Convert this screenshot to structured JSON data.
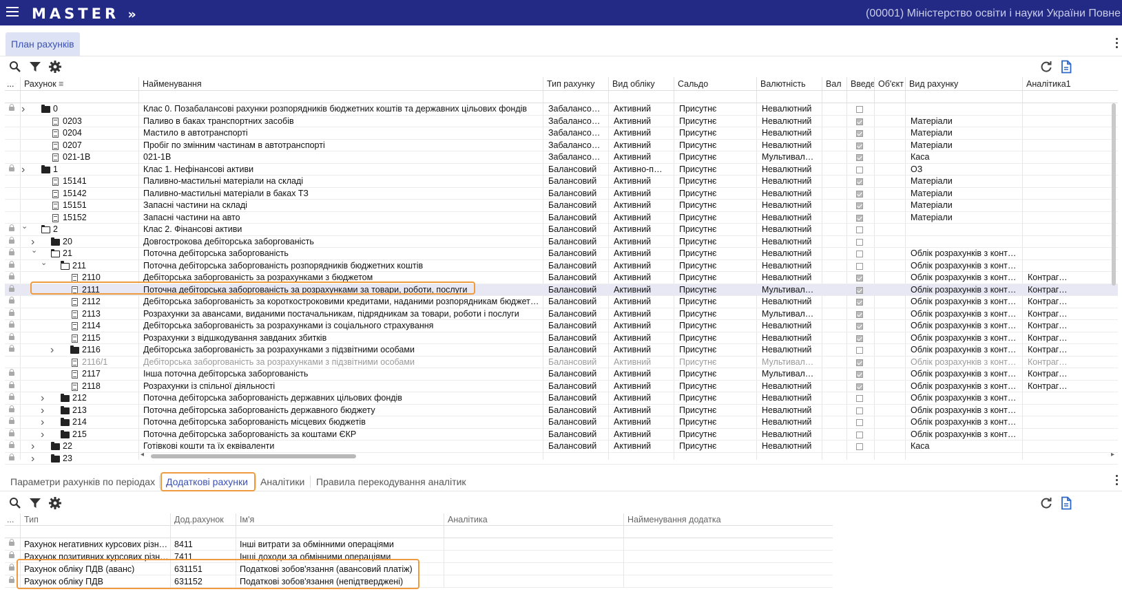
{
  "header": {
    "logo": "MASTER",
    "logo_suffix": "»",
    "org": "(00001) Міністерство освіти і науки України Повне"
  },
  "main_tab": {
    "label": "План рахунків"
  },
  "grid": {
    "columns": [
      "...",
      "Рахунок",
      "Найменування",
      "Тип рахунку",
      "Вид обліку",
      "Сальдо",
      "Валютність",
      "Вал",
      "Введен",
      "Об'єкт",
      "Вид рахунку",
      "Аналітика1"
    ],
    "rows": [
      {
        "lock": true,
        "chev": ">",
        "icon": "folder",
        "level": 0,
        "code": "0",
        "name": "Клас 0. Позабалансові рахунки розпорядників бюджетних коштів та державних цільових фондів",
        "type": "Забалансо…",
        "kind": "Активний",
        "saldo": "Присутнє",
        "cur": "Невалютний",
        "cb": false,
        "vid": "",
        "an": ""
      },
      {
        "lock": false,
        "chev": "",
        "icon": "doc",
        "level": 1,
        "code": "0203",
        "name": "Паливо в баках транспортних засобів",
        "type": "Забалансо…",
        "kind": "Активний",
        "saldo": "Присутнє",
        "cur": "Невалютний",
        "cb": true,
        "vid": "Матеріали",
        "an": ""
      },
      {
        "lock": false,
        "chev": "",
        "icon": "doc",
        "level": 1,
        "code": "0204",
        "name": "Мастило в автотранспорті",
        "type": "Забалансо…",
        "kind": "Активний",
        "saldo": "Присутнє",
        "cur": "Невалютний",
        "cb": true,
        "vid": "Матеріали",
        "an": ""
      },
      {
        "lock": false,
        "chev": "",
        "icon": "doc",
        "level": 1,
        "code": "0207",
        "name": "Пробіг по змінним частинам в автотранспорті",
        "type": "Забалансо…",
        "kind": "Активний",
        "saldo": "Присутнє",
        "cur": "Невалютний",
        "cb": true,
        "vid": "Матеріали",
        "an": ""
      },
      {
        "lock": false,
        "chev": "",
        "icon": "doc",
        "level": 1,
        "code": "021-1В",
        "name": "021-1В",
        "type": "Забалансо…",
        "kind": "Активний",
        "saldo": "Присутнє",
        "cur": "Мультивал…",
        "cb": true,
        "vid": "Каса",
        "an": ""
      },
      {
        "lock": true,
        "chev": ">",
        "icon": "folder",
        "level": 0,
        "code": "1",
        "name": "Клас 1. Нефінансові активи",
        "type": "Балансовий",
        "kind": "Активно-п…",
        "saldo": "Присутнє",
        "cur": "Невалютний",
        "cb": false,
        "vid": "ОЗ",
        "an": ""
      },
      {
        "lock": false,
        "chev": "",
        "icon": "doc",
        "level": 1,
        "code": "15141",
        "name": "Паливно-мастильні матеріали на складі",
        "type": "Балансовий",
        "kind": "Активний",
        "saldo": "Присутнє",
        "cur": "Невалютний",
        "cb": true,
        "vid": "Матеріали",
        "an": ""
      },
      {
        "lock": false,
        "chev": "",
        "icon": "doc",
        "level": 1,
        "code": "15142",
        "name": "Паливно-мастильні матеріали в баках ТЗ",
        "type": "Балансовий",
        "kind": "Активний",
        "saldo": "Присутнє",
        "cur": "Невалютний",
        "cb": true,
        "vid": "Матеріали",
        "an": ""
      },
      {
        "lock": false,
        "chev": "",
        "icon": "doc",
        "level": 1,
        "code": "15151",
        "name": "Запасні частини на складі",
        "type": "Балансовий",
        "kind": "Активний",
        "saldo": "Присутнє",
        "cur": "Невалютний",
        "cb": true,
        "vid": "Матеріали",
        "an": ""
      },
      {
        "lock": false,
        "chev": "",
        "icon": "doc",
        "level": 1,
        "code": "15152",
        "name": "Запасні частини на авто",
        "type": "Балансовий",
        "kind": "Активний",
        "saldo": "Присутнє",
        "cur": "Невалютний",
        "cb": true,
        "vid": "Матеріали",
        "an": ""
      },
      {
        "lock": true,
        "chev": "v",
        "icon": "folder-open",
        "level": 0,
        "code": "2",
        "name": "Клас 2. Фінансові активи",
        "type": "Балансовий",
        "kind": "Активний",
        "saldo": "Присутнє",
        "cur": "Невалютний",
        "cb": false,
        "vid": "",
        "an": ""
      },
      {
        "lock": true,
        "chev": ">",
        "icon": "folder",
        "level": 1,
        "code": "20",
        "name": "Довгострокова дебіторська заборгованість",
        "type": "Балансовий",
        "kind": "Активний",
        "saldo": "Присутнє",
        "cur": "Невалютний",
        "cb": false,
        "vid": "",
        "an": ""
      },
      {
        "lock": true,
        "chev": "v",
        "icon": "folder-open",
        "level": 1,
        "code": "21",
        "name": "Поточна дебіторська заборгованість",
        "type": "Балансовий",
        "kind": "Активний",
        "saldo": "Присутнє",
        "cur": "Невалютний",
        "cb": false,
        "vid": "Облік розрахунків з контрагентами",
        "an": ""
      },
      {
        "lock": true,
        "chev": "v",
        "icon": "folder-open",
        "level": 2,
        "code": "211",
        "name": "Поточна дебіторська заборгованість розпорядників бюджетних коштів",
        "type": "Балансовий",
        "kind": "Активний",
        "saldo": "Присутнє",
        "cur": "Невалютний",
        "cb": false,
        "vid": "Облік розрахунків з контрагентами",
        "an": ""
      },
      {
        "lock": true,
        "chev": "",
        "icon": "doc",
        "level": 3,
        "code": "2110",
        "name": "Дебіторська заборгованість за розрахунками з бюджетом",
        "type": "Балансовий",
        "kind": "Активний",
        "saldo": "Присутнє",
        "cur": "Невалютний",
        "cb": true,
        "vid": "Облік розрахунків з контрагентами",
        "an": "Контрагенти"
      },
      {
        "lock": true,
        "chev": "",
        "icon": "doc",
        "level": 3,
        "code": "2111",
        "name": "Поточна дебіторська заборгованість за розрахунками за товари, роботи, послуги",
        "type": "Балансовий",
        "kind": "Активний",
        "saldo": "Присутнє",
        "cur": "Мультивал…",
        "cb": true,
        "vid": "Облік розрахунків з контрагентами",
        "an": "Контрагенти",
        "selected": true
      },
      {
        "lock": true,
        "chev": "",
        "icon": "doc",
        "level": 3,
        "code": "2112",
        "name": "Дебіторська заборгованість за короткостроковими кредитами, наданими розпорядникам бюджетних коштів",
        "type": "Балансовий",
        "kind": "Активний",
        "saldo": "Присутнє",
        "cur": "Невалютний",
        "cb": true,
        "vid": "Облік розрахунків з контрагентами",
        "an": "Контрагенти"
      },
      {
        "lock": true,
        "chev": "",
        "icon": "doc",
        "level": 3,
        "code": "2113",
        "name": "Розрахунки за авансами, виданими постачальникам, підрядникам за товари, роботи і послуги",
        "type": "Балансовий",
        "kind": "Активний",
        "saldo": "Присутнє",
        "cur": "Мультивал…",
        "cb": true,
        "vid": "Облік розрахунків з контрагентами",
        "an": "Контрагенти"
      },
      {
        "lock": true,
        "chev": "",
        "icon": "doc",
        "level": 3,
        "code": "2114",
        "name": "Дебіторська заборгованість за розрахунками із соціального страхування",
        "type": "Балансовий",
        "kind": "Активний",
        "saldo": "Присутнє",
        "cur": "Невалютний",
        "cb": true,
        "vid": "Облік розрахунків з контрагентами",
        "an": "Контрагенти"
      },
      {
        "lock": true,
        "chev": "",
        "icon": "doc",
        "level": 3,
        "code": "2115",
        "name": "Розрахунки з відшкодування завданих збитків",
        "type": "Балансовий",
        "kind": "Активний",
        "saldo": "Присутнє",
        "cur": "Невалютний",
        "cb": true,
        "vid": "Облік розрахунків з контрагентами",
        "an": "Контрагенти"
      },
      {
        "lock": true,
        "chev": ">",
        "icon": "folder",
        "level": 3,
        "code": "2116",
        "name": "Дебіторська заборгованість за розрахунками з підзвітними особами",
        "type": "Балансовий",
        "kind": "Активний",
        "saldo": "Присутнє",
        "cur": "Невалютний",
        "cb": false,
        "vid": "Облік розрахунків з контрагентами",
        "an": "Контрагенти"
      },
      {
        "lock": false,
        "chev": "",
        "icon": "doc",
        "level": 3,
        "code": "2116/1",
        "name": "Дебіторська заборгованість за розрахунками з підзвітними особами",
        "type": "Балансовий",
        "kind": "Активний",
        "saldo": "Присутнє",
        "cur": "Мультивал…",
        "cb": true,
        "vid": "Облік розрахунків з контрагентами",
        "an": "Контрагенти",
        "dim": true
      },
      {
        "lock": true,
        "chev": "",
        "icon": "doc",
        "level": 3,
        "code": "2117",
        "name": "Інша поточна дебіторська заборгованість",
        "type": "Балансовий",
        "kind": "Активний",
        "saldo": "Присутнє",
        "cur": "Мультивал…",
        "cb": true,
        "vid": "Облік розрахунків з контрагентами",
        "an": "Контрагенти"
      },
      {
        "lock": true,
        "chev": "",
        "icon": "doc",
        "level": 3,
        "code": "2118",
        "name": "Розрахунки із спільної діяльності",
        "type": "Балансовий",
        "kind": "Активний",
        "saldo": "Присутнє",
        "cur": "Невалютний",
        "cb": true,
        "vid": "Облік розрахунків з контрагентами",
        "an": "Контрагенти"
      },
      {
        "lock": true,
        "chev": ">",
        "icon": "folder",
        "level": 2,
        "code": "212",
        "name": "Поточна дебіторська заборгованість державних цільових фондів",
        "type": "Балансовий",
        "kind": "Активний",
        "saldo": "Присутнє",
        "cur": "Невалютний",
        "cb": false,
        "vid": "Облік розрахунків з контрагентами",
        "an": ""
      },
      {
        "lock": true,
        "chev": ">",
        "icon": "folder",
        "level": 2,
        "code": "213",
        "name": "Поточна дебіторська заборгованість державного бюджету",
        "type": "Балансовий",
        "kind": "Активний",
        "saldo": "Присутнє",
        "cur": "Невалютний",
        "cb": false,
        "vid": "Облік розрахунків з контрагентами",
        "an": ""
      },
      {
        "lock": true,
        "chev": ">",
        "icon": "folder",
        "level": 2,
        "code": "214",
        "name": "Поточна дебіторська заборгованість місцевих бюджетів",
        "type": "Балансовий",
        "kind": "Активний",
        "saldo": "Присутнє",
        "cur": "Невалютний",
        "cb": false,
        "vid": "Облік розрахунків з контрагентами",
        "an": ""
      },
      {
        "lock": true,
        "chev": ">",
        "icon": "folder",
        "level": 2,
        "code": "215",
        "name": "Поточна дебіторська заборгованість за коштами ЄКР",
        "type": "Балансовий",
        "kind": "Активний",
        "saldo": "Присутнє",
        "cur": "Невалютний",
        "cb": false,
        "vid": "Облік розрахунків з контрагентами",
        "an": ""
      },
      {
        "lock": true,
        "chev": ">",
        "icon": "folder",
        "level": 1,
        "code": "22",
        "name": "Готівкові кошти та їх еквіваленти",
        "type": "Балансовий",
        "kind": "Активний",
        "saldo": "Присутнє",
        "cur": "Невалютний",
        "cb": false,
        "vid": "Каса",
        "an": ""
      },
      {
        "lock": true,
        "chev": ">",
        "icon": "folder",
        "level": 1,
        "code": "23",
        "name": "",
        "type": "",
        "kind": "",
        "saldo": "",
        "cur": "",
        "cb": null,
        "vid": "",
        "an": ""
      }
    ]
  },
  "subtabs": [
    "Параметри рахунків по періодах",
    "Додаткові рахунки",
    "Аналітики",
    "Правила перекодування аналітик"
  ],
  "grid2": {
    "columns": [
      "...",
      "Тип",
      "Дод.рахунок",
      "Ім'я",
      "Аналітика",
      "Найменування додатка"
    ],
    "rows": [
      {
        "type": "Рахунок негативних курсових різниць",
        "acc": "8411",
        "name": "Інші витрати за обмінними операціями"
      },
      {
        "type": "Рахунок позитивних курсових різниць",
        "acc": "7411",
        "name": "Інші доходи за обмінними операціями"
      },
      {
        "type": "Рахунок обліку ПДВ (аванс)",
        "acc": "631151",
        "name": "Податкові зобов'язання (авансовий платіж)"
      },
      {
        "type": "Рахунок обліку ПДВ",
        "acc": "631152",
        "name": "Податкові зобов'язання (непідтверджені)"
      }
    ]
  },
  "colors": {
    "header_bg": "#232a86",
    "accent": "#3b52b4",
    "highlight": "#f09a3e"
  }
}
